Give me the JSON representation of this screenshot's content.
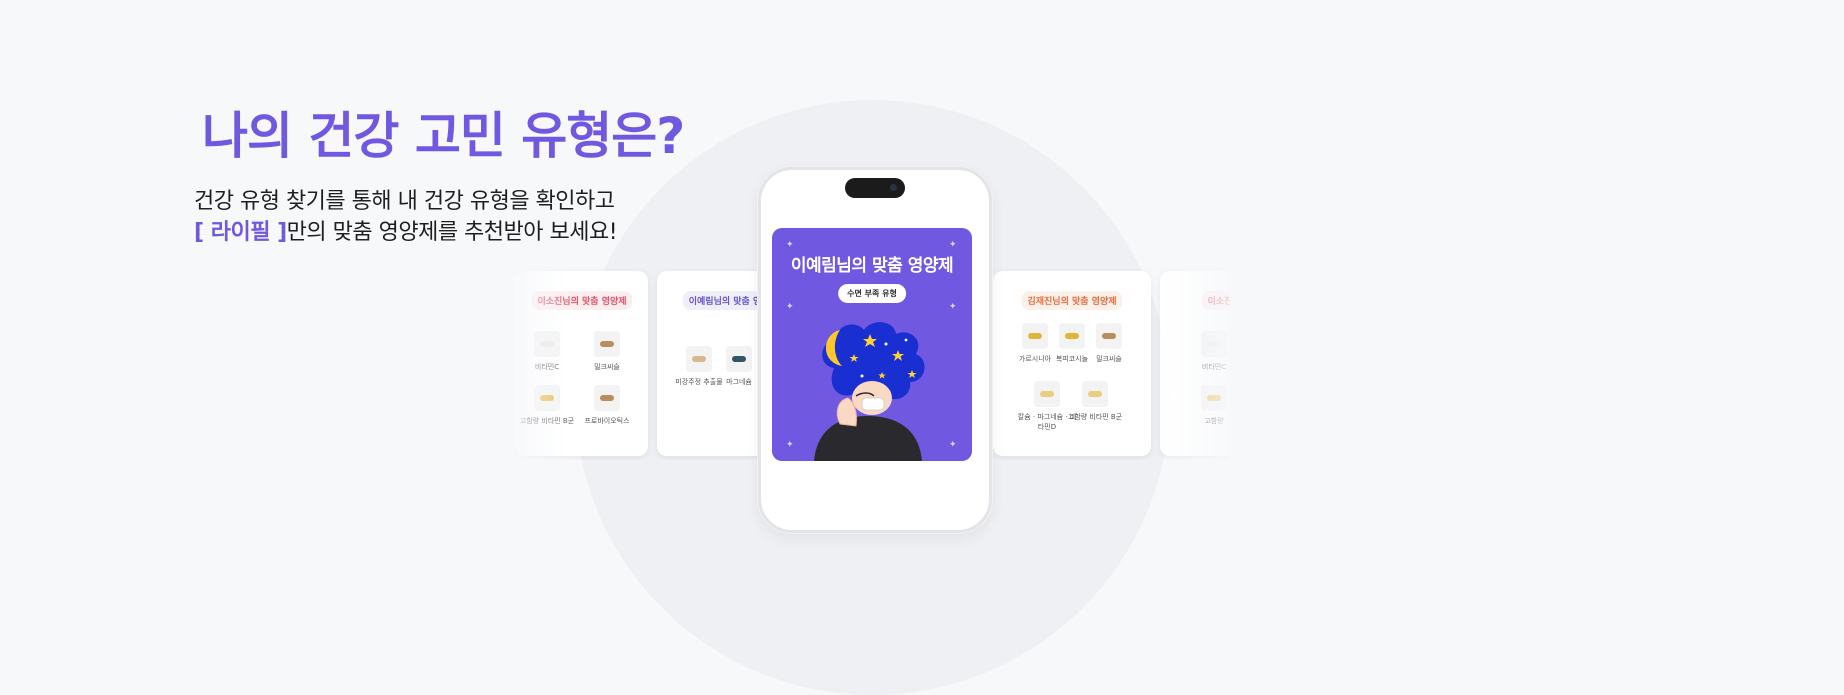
{
  "hero": {
    "headline": "나의 건강 고민 유형은?",
    "description_line1": "건강 유형 찾기를 통해 내 건강 유형을 확인하고",
    "brand": "[ 라이필 ]",
    "description_line2_rest": "만의 맞춤 영양제를 추천받아 보세요!"
  },
  "colors": {
    "accent": "#7059e0",
    "background": "#f7f8fa"
  },
  "phone": {
    "card_title": "이예림님의 맞춤 영양제",
    "card_badge": "수면 부족 유형",
    "illustration": "sleepy-person-night-sky"
  },
  "cards": [
    {
      "title": "이소진님의 맞춤 영양제",
      "title_color": "#e0556a",
      "items": [
        {
          "label": "비타민C",
          "color": "#e8e8e8"
        },
        {
          "label": "밀크씨슬",
          "color": "#b98d5e"
        },
        {
          "label": "고함량 비타민 B군",
          "color": "#e8bd54"
        },
        {
          "label": "프로바이오틱스",
          "color": "#b98d5e"
        }
      ]
    },
    {
      "title": "이예림님의 맞춤 영",
      "title_color": "#6556c9",
      "items": [
        {
          "label": "미강주정 추출물",
          "color": "#d8b790"
        },
        {
          "label": "마그네슘",
          "color": "#345566"
        }
      ]
    },
    {
      "title": "김재진님의 맞춤 영양제",
      "title_color": "#e0703e",
      "items": [
        {
          "label": "가르시니아",
          "color": "#e3b43c"
        },
        {
          "label": "복피코시놀",
          "color": "#e3b43c"
        },
        {
          "label": "밀크씨슬",
          "color": "#b98d5e"
        },
        {
          "label": "칼슘 · 마그네슘 · 비타민D",
          "color": "#e8cf7d"
        },
        {
          "label": "고함량 비타민 B군",
          "color": "#e8cf7d"
        }
      ]
    },
    {
      "title": "이소진",
      "title_color": "#e0556a",
      "items": [
        {
          "label": "비타민C",
          "color": "#e8e8e8"
        },
        {
          "label": "고함량",
          "color": "#e8bd54"
        }
      ]
    }
  ]
}
